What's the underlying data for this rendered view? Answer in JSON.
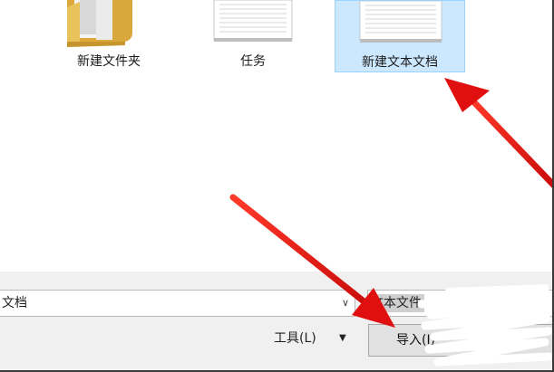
{
  "files": [
    {
      "name": "新建文件夹",
      "icon": "folder-icon"
    },
    {
      "name": "任务",
      "icon": "text-document-icon"
    },
    {
      "name": "新建文本文档",
      "icon": "text-document-icon",
      "selected": true
    }
  ],
  "footer": {
    "filename_value": "文档",
    "filetype_value": "文本文件",
    "tools_label": "工具(L)",
    "import_label": "导入(I)"
  },
  "colors": {
    "selection_bg": "#cce8ff",
    "selection_border": "#99d1ff",
    "folder_yellow": "#e8c25a",
    "annotation_arrow": "#e01010",
    "panel_bg": "#f0f0f0"
  }
}
